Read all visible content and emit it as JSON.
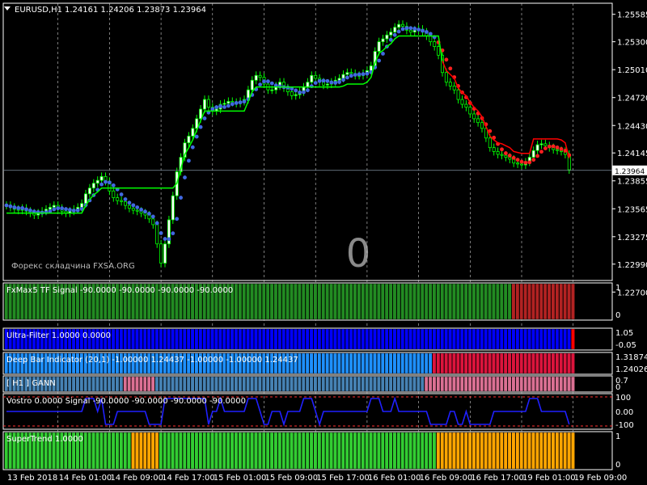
{
  "chart_data": {
    "type": "candlestick",
    "symbol_header": "EURUSD,H1",
    "ohlc_header": [
      "1.24161",
      "1.24206",
      "1.23873",
      "1.23964"
    ],
    "current_price": "1.23964",
    "price_ylim": [
      1.2282,
      1.257
    ],
    "price_ticks": [
      "1.25585",
      "1.25300",
      "1.25010",
      "1.24720",
      "1.24430",
      "1.24145",
      "1.23855",
      "1.23565",
      "1.23275",
      "1.22990",
      "1.22700"
    ],
    "close": [
      1.236,
      1.2358,
      1.2356,
      1.2355,
      1.2357,
      1.2354,
      1.2352,
      1.235,
      1.2352,
      1.2354,
      1.2356,
      1.2358,
      1.236,
      1.2357,
      1.2354,
      1.2352,
      1.2354,
      1.2356,
      1.2358,
      1.2362,
      1.2372,
      1.2378,
      1.2383,
      1.2386,
      1.239,
      1.2385,
      1.2375,
      1.2368,
      1.2365,
      1.2364,
      1.236,
      1.2357,
      1.2355,
      1.2354,
      1.2352,
      1.235,
      1.2346,
      1.234,
      1.232,
      1.23,
      1.232,
      1.2345,
      1.237,
      1.2395,
      1.241,
      1.2425,
      1.2432,
      1.244,
      1.245,
      1.246,
      1.247,
      1.2462,
      1.2458,
      1.246,
      1.2465,
      1.2466,
      1.2468,
      1.2467,
      1.2466,
      1.2468,
      1.247,
      1.248,
      1.249,
      1.2495,
      1.2493,
      1.2486,
      1.248,
      1.248,
      1.2484,
      1.2488,
      1.2482,
      1.2478,
      1.2474,
      1.2475,
      1.2478,
      1.2483,
      1.2488,
      1.2495,
      1.2492,
      1.2488,
      1.2485,
      1.2486,
      1.2488,
      1.249,
      1.2492,
      1.2496,
      1.2498,
      1.2497,
      1.2495,
      1.2495,
      1.2497,
      1.25,
      1.2505,
      1.252,
      1.253,
      1.2533,
      1.2537,
      1.254,
      1.2545,
      1.2548,
      1.2546,
      1.2542,
      1.254,
      1.2542,
      1.2543,
      1.254,
      1.2536,
      1.253,
      1.2525,
      1.2516,
      1.2498,
      1.2488,
      1.2484,
      1.248,
      1.247,
      1.2465,
      1.2462,
      1.2455,
      1.245,
      1.2446,
      1.244,
      1.243,
      1.242,
      1.2416,
      1.2413,
      1.2412,
      1.241,
      1.2408,
      1.2404,
      1.2403,
      1.2402,
      1.2405,
      1.241,
      1.2417,
      1.2423,
      1.2424,
      1.2422,
      1.242,
      1.2418,
      1.2417,
      1.2416,
      1.2413,
      1.2397
    ],
    "supertrend_line_color": [
      "#00ff00",
      "#ff0000"
    ],
    "annotations": {
      "watermark": "0",
      "footer_text": "Форекс складчина FXSA.ORG"
    },
    "time_labels": [
      "13 Feb 2018",
      "14 Feb 01:00",
      "14 Feb 09:00",
      "14 Feb 17:00",
      "15 Feb 01:00",
      "15 Feb 09:00",
      "15 Feb 17:00",
      "16 Feb 01:00",
      "16 Feb 09:00",
      "16 Feb 17:00",
      "19 Feb 01:00",
      "19 Feb 09:00"
    ],
    "indicators": [
      {
        "label": "FxMax5 TF  Signal -90.0000 -90.0000 -90.0000 -90.0000",
        "scale": [
          "1",
          "0"
        ],
        "segments": [
          {
            "color": "#228b22",
            "bars": 128
          },
          {
            "color": "#b22222",
            "bars": 16
          }
        ]
      },
      {
        "label": "Ultra-Filter 1.0000 0.0000",
        "scale": [
          "1.05",
          "-0.05"
        ],
        "segments": [
          {
            "color": "#0000ff",
            "bars": 143
          },
          {
            "color": "#ff0000",
            "bars": 1
          }
        ]
      },
      {
        "label": "Deep Bar Indicator (20,1) -1.00000 1.24437 -1.00000 -1.00000 1.24437",
        "scale": [
          "1.31874",
          "1.24026"
        ],
        "segments": [
          {
            "color": "#1e90ff",
            "bars": 108
          },
          {
            "color": "#dc143c",
            "bars": 36
          }
        ]
      },
      {
        "label": "[ H1 ] GANN",
        "scale": [
          "0.7",
          "0"
        ],
        "segments": [
          {
            "color": "#4682b4",
            "bars": 30
          },
          {
            "color": "#db7093",
            "bars": 8
          },
          {
            "color": "#4682b4",
            "bars": 68
          },
          {
            "color": "#db7093",
            "bars": 38
          }
        ]
      },
      {
        "label": "Vostro       0.0000  Signal -90.0000 -90.0000 -90.0000 -90.0000",
        "scale": [
          "100",
          "0.00",
          "-100"
        ]
      },
      {
        "label": "SuperTrend 1.0000",
        "scale": [
          "1",
          "0"
        ],
        "segments": [
          {
            "color": "#32cd32",
            "bars": 32
          },
          {
            "color": "#ffa500",
            "bars": 7
          },
          {
            "color": "#32cd32",
            "bars": 70
          },
          {
            "color": "#ffa500",
            "bars": 35
          }
        ]
      }
    ]
  }
}
